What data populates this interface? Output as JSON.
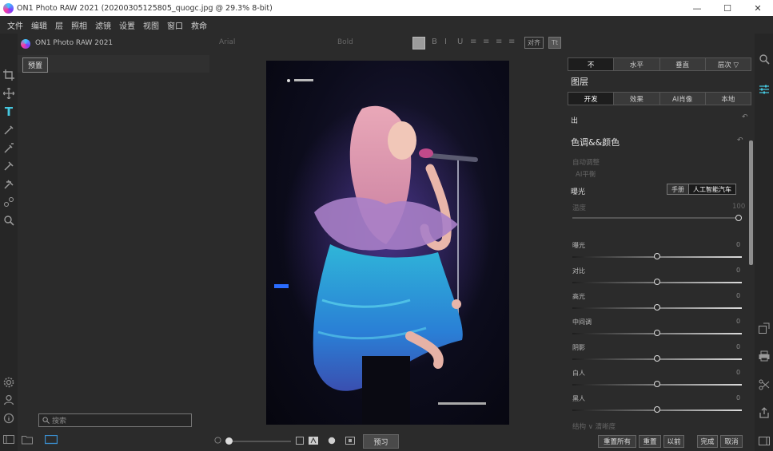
{
  "window": {
    "title": "ON1 Photo RAW 2021 (20200305125805_quogc.jpg @ 29.3% 8-bit)",
    "minimize": "—",
    "maximize": "☐",
    "close": "✕"
  },
  "menu": [
    "文件",
    "编辑",
    "层",
    "照相",
    "滤镜",
    "设置",
    "视图",
    "窗口",
    "救命"
  ],
  "left_panel": {
    "module_name": "ON1 Photo RAW 2021",
    "presets_tab": "预置",
    "search_placeholder": "搜索"
  },
  "top_toolbar": {
    "left_dim": "Arial",
    "mid_dim": "Bold",
    "swatch_color": "#9c9c9c",
    "icons": [
      "B",
      "I",
      "U",
      "≡",
      "≡",
      "≡",
      "≡"
    ],
    "box1": "对齐",
    "box2": "Tt"
  },
  "bottom_toolbar": {
    "preview_label": "预习"
  },
  "right_panel": {
    "view_tabs": [
      "不",
      "水平",
      "垂直",
      "层次 ▽"
    ],
    "layers_title": "图层",
    "edit_tabs": [
      "开发",
      "效果",
      "AI肖像",
      "本地"
    ],
    "edit_tabs_active": 0,
    "export_label": "出",
    "section_title": "色调&&颜色",
    "dim_line1": "自动调整",
    "dim_line2": "AI平衡",
    "amount_label": "曝光",
    "mode_manual": "手册",
    "mode_ai": "人工智能汽车",
    "temp_label": "温度",
    "temp_value": "100",
    "sliders": [
      {
        "label": "曝光",
        "value": "0",
        "pos": 0.5
      },
      {
        "label": "对比",
        "value": "0",
        "pos": 0.5
      },
      {
        "label": "高光",
        "value": "0",
        "pos": 0.5
      },
      {
        "label": "中间调",
        "value": "0",
        "pos": 0.5
      },
      {
        "label": "阴影",
        "value": "0",
        "pos": 0.5
      },
      {
        "label": "白人",
        "value": "0",
        "pos": 0.5
      },
      {
        "label": "黑人",
        "value": "0",
        "pos": 0.5
      }
    ],
    "cut_text": "结构 ∨ 清晰度",
    "reset_all": "重置所有",
    "reset": "重置",
    "before": "以前",
    "done": "完成",
    "cancel": "取消"
  }
}
